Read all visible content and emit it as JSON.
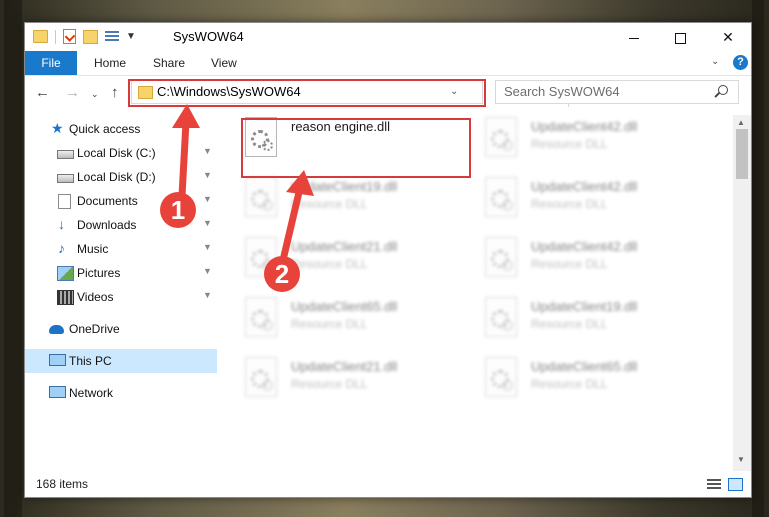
{
  "window": {
    "title": "SysWOW64",
    "minimize_glyph": "minimize",
    "maximize_glyph": "maximize",
    "close_glyph": "✕"
  },
  "ribbon": {
    "tabs": [
      "File",
      "Home",
      "Share",
      "View"
    ],
    "expand_glyph": "⌄",
    "help_glyph": "?"
  },
  "navigation": {
    "back_glyph": "←",
    "forward_glyph": "→",
    "recent_glyph": "⌄",
    "up_glyph": "↑",
    "address": "C:\\Windows\\SysWOW64",
    "address_dropdown_glyph": "⌄",
    "refresh_glyph": "↻",
    "search_placeholder": "Search SysWOW64"
  },
  "sidebar": {
    "items": [
      {
        "label": "Quick access",
        "icon": "star-icon",
        "pinned": false
      },
      {
        "label": "Local Disk (C:)",
        "icon": "drive-icon",
        "pinned": true
      },
      {
        "label": "Local Disk (D:)",
        "icon": "drive-icon",
        "pinned": true
      },
      {
        "label": "Documents",
        "icon": "document-icon",
        "pinned": true
      },
      {
        "label": "Downloads",
        "icon": "download-icon",
        "pinned": true
      },
      {
        "label": "Music",
        "icon": "music-icon",
        "pinned": true
      },
      {
        "label": "Pictures",
        "icon": "pictures-icon",
        "pinned": true
      },
      {
        "label": "Videos",
        "icon": "video-icon",
        "pinned": true
      },
      {
        "label": "OneDrive",
        "icon": "cloud-icon",
        "pinned": false
      },
      {
        "label": "This PC",
        "icon": "computer-icon",
        "pinned": false,
        "selected": true
      },
      {
        "label": "Network",
        "icon": "network-icon",
        "pinned": false
      }
    ],
    "pin_glyph": "📌"
  },
  "files": [
    {
      "name": "reason engine.dll",
      "type": "",
      "highlighted": true
    },
    {
      "name": "UpdateClient42.dll",
      "type": "Resource DLL"
    },
    {
      "name": "UpdateClient19.dll",
      "type": "Resource DLL"
    },
    {
      "name": "UpdateClient42.dll",
      "type": "Resource DLL"
    },
    {
      "name": "UpdateClient21.dll",
      "type": "Resource DLL"
    },
    {
      "name": "UpdateClient42.dll",
      "type": "Resource DLL"
    },
    {
      "name": "UpdateClient65.dll",
      "type": "Resource DLL"
    },
    {
      "name": "UpdateClient19.dll",
      "type": "Resource DLL"
    },
    {
      "name": "UpdateClient21.dll",
      "type": "Resource DLL"
    },
    {
      "name": "UpdateClient65.dll",
      "type": "Resource DLL"
    }
  ],
  "status": {
    "item_count": "168 items"
  },
  "annotations": {
    "step1": "1",
    "step2": "2",
    "color": "#e8433b"
  },
  "colors": {
    "accent": "#1979ca",
    "highlight_box": "#d63a3a",
    "selection": "#cce8ff"
  }
}
